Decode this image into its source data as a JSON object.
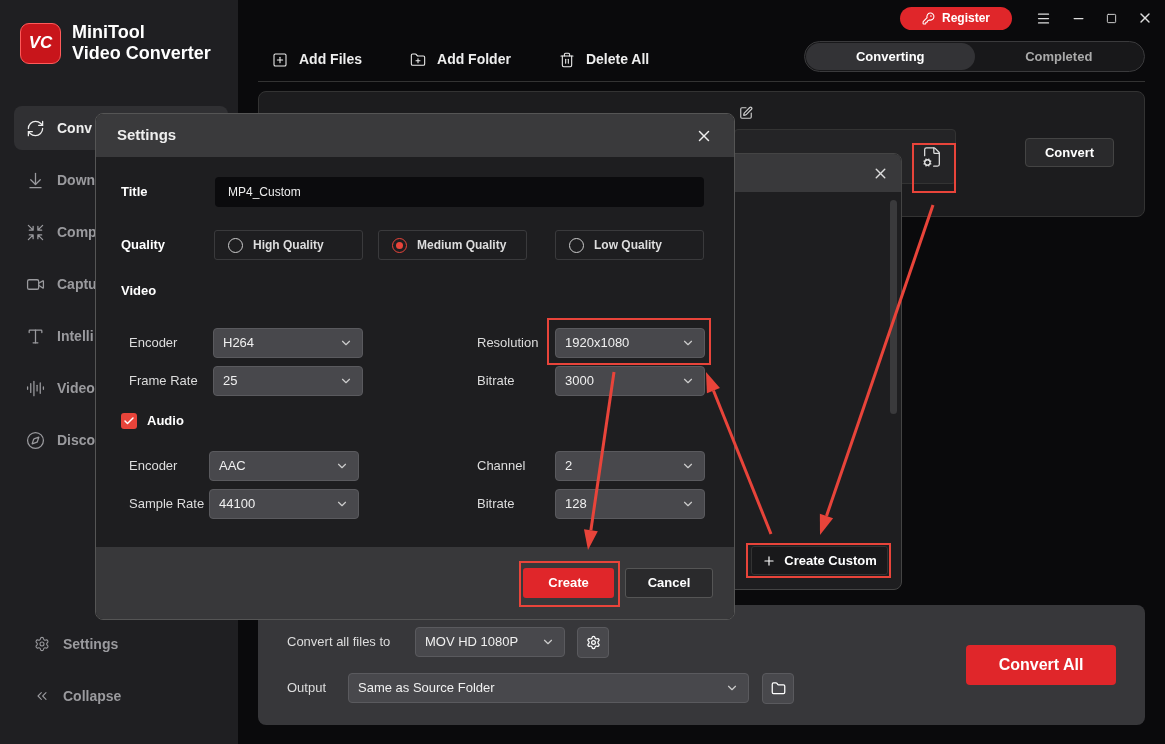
{
  "app": {
    "logo_text": "VC",
    "name_line1": "MiniTool",
    "name_line2": "Video Converter"
  },
  "title_bar": {
    "register": "Register"
  },
  "sidebar": {
    "items": [
      {
        "label": "Conv",
        "kind": "convert",
        "selected": true
      },
      {
        "label": "Down",
        "kind": "download",
        "selected": false
      },
      {
        "label": "Comp",
        "kind": "compress",
        "selected": false
      },
      {
        "label": "Captu",
        "kind": "capture",
        "selected": false
      },
      {
        "label": "Intelli",
        "kind": "text",
        "selected": false
      },
      {
        "label": "Video",
        "kind": "edit",
        "selected": false
      },
      {
        "label": "Disco",
        "kind": "discover",
        "selected": false
      }
    ],
    "footer": [
      {
        "label": "Settings",
        "kind": "settings"
      },
      {
        "label": "Collapse",
        "kind": "collapse"
      }
    ]
  },
  "toolbar": {
    "actions": [
      {
        "label": "Add Files",
        "kind": "add"
      },
      {
        "label": "Add Folder",
        "kind": "folder"
      },
      {
        "label": "Delete All",
        "kind": "delete"
      }
    ]
  },
  "tabs": [
    {
      "label": "Converting",
      "selected": true
    },
    {
      "label": "Completed",
      "selected": false
    }
  ],
  "task": {
    "convert_button": "Convert"
  },
  "format_popup": {
    "create_custom": "Create Custom"
  },
  "settings_dialog": {
    "title": "Settings",
    "title_label": "Title",
    "title_value": "MP4_Custom",
    "quality_label": "Quality",
    "quality_options": [
      {
        "label": "High Quality",
        "selected": false
      },
      {
        "label": "Medium Quality",
        "selected": true
      },
      {
        "label": "Low Quality",
        "selected": false
      }
    ],
    "video_label": "Video",
    "video_fields": [
      {
        "label": "Encoder",
        "value": "H264"
      },
      {
        "label": "Resolution",
        "value": "1920x1080"
      },
      {
        "label": "Frame Rate",
        "value": "25"
      },
      {
        "label": "Bitrate",
        "value": "3000"
      }
    ],
    "audio": {
      "label": "Audio",
      "checked": true,
      "fields": [
        {
          "label": "Encoder",
          "value": "AAC"
        },
        {
          "label": "Channel",
          "value": "2"
        },
        {
          "label": "Sample Rate",
          "value": "44100"
        },
        {
          "label": "Bitrate",
          "value": "128"
        }
      ]
    },
    "create": "Create",
    "cancel": "Cancel"
  },
  "bottom": {
    "convert_label": "Convert all files to",
    "format": "MOV HD 1080P",
    "output_label": "Output",
    "output": "Same as Source Folder",
    "convert_all": "Convert All"
  }
}
